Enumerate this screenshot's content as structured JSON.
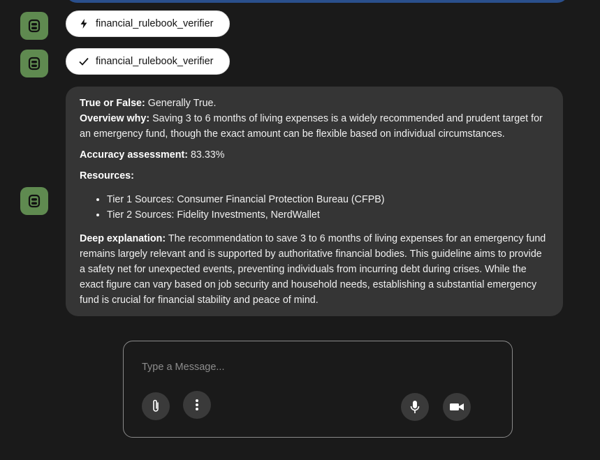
{
  "chat": {
    "tool_calls": [
      {
        "icon": "lightning-icon",
        "label": "financial_rulebook_verifier",
        "state": "running"
      },
      {
        "icon": "check-icon",
        "label": "financial_rulebook_verifier",
        "state": "done"
      }
    ],
    "answer": {
      "true_false_label": "True or False:",
      "true_false_value": " Generally True.",
      "overview_label": "Overview why:",
      "overview_value": " Saving 3 to 6 months of living expenses is a widely recommended and prudent target for an emergency fund, though the exact amount can be flexible based on individual circumstances.",
      "accuracy_label": "Accuracy assessment:",
      "accuracy_value": " 83.33%",
      "resources_label": "Resources:",
      "resources": [
        "Tier 1 Sources: Consumer Financial Protection Bureau (CFPB)",
        "Tier 2 Sources: Fidelity Investments, NerdWallet"
      ],
      "deep_label": "Deep explanation:",
      "deep_value": " The recommendation to save 3 to 6 months of living expenses for an emergency fund remains largely relevant and is supported by authoritative financial bodies. This guideline aims to provide a safety net for unexpected events, preventing individuals from incurring debt during crises. While the exact figure can vary based on job security and household needs, establishing a substantial emergency fund is crucial for financial stability and peace of mind."
    }
  },
  "composer": {
    "placeholder": "Type a Message...",
    "buttons": [
      "paperclip-icon",
      "more-vertical-icon",
      "microphone-icon",
      "video-camera-icon"
    ]
  },
  "colors": {
    "background": "#1a1a1a",
    "bubble": "#353535",
    "avatar": "#5f8a50",
    "pill": "#ffffff"
  }
}
